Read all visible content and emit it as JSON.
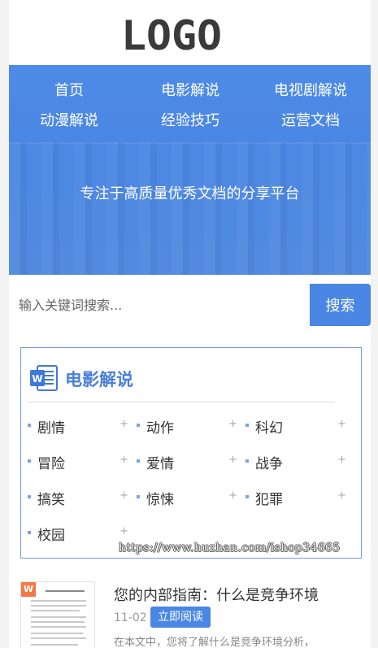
{
  "header": {
    "logo_text": "LOGO"
  },
  "nav": {
    "items": [
      {
        "label": "首页"
      },
      {
        "label": "电影解说"
      },
      {
        "label": "电视剧解说"
      },
      {
        "label": "动漫解说"
      },
      {
        "label": "经验技巧"
      },
      {
        "label": "运营文档"
      }
    ]
  },
  "hero": {
    "slogan": "专注于高质量优秀文档的分享平台"
  },
  "search": {
    "placeholder": "输入关键词搜索...",
    "button_label": "搜索"
  },
  "category": {
    "title": "电影解说",
    "icon": "word-doc-icon",
    "items": [
      {
        "label": "剧情"
      },
      {
        "label": "动作"
      },
      {
        "label": "科幻"
      },
      {
        "label": "冒险"
      },
      {
        "label": "爱情"
      },
      {
        "label": "战争"
      },
      {
        "label": "搞笑"
      },
      {
        "label": "惊悚"
      },
      {
        "label": "犯罪"
      },
      {
        "label": "校园"
      }
    ],
    "plus_symbol": "+"
  },
  "watermark": "https://www.huzhan.com/ishop34665",
  "article": {
    "title": "您的内部指南：什么是竞争环境",
    "date": "11-02",
    "read_button": "立即阅读",
    "excerpt": "在本文中，您将了解什么是竞争环境分析，",
    "thumb_badge": "W"
  },
  "colors": {
    "brand": "#4a86e3",
    "accent_title": "#4a7fd8",
    "badge": "#f07a46"
  }
}
